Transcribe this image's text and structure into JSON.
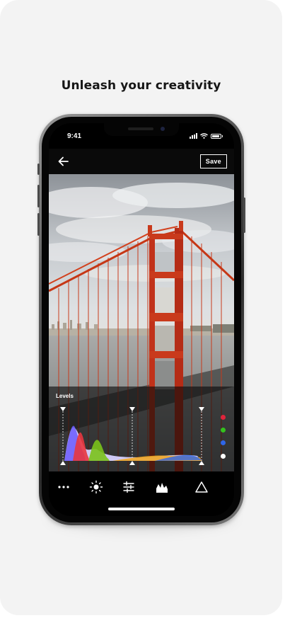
{
  "headline": "Unleash your creativity",
  "status": {
    "time": "9:41"
  },
  "editor": {
    "save_label": "Save",
    "panel_title": "Levels",
    "channel_dots": [
      {
        "name": "red-channel-dot",
        "color": "#e0243b"
      },
      {
        "name": "green-channel-dot",
        "color": "#34c11e"
      },
      {
        "name": "blue-channel-dot",
        "color": "#2f66e8"
      },
      {
        "name": "luminance-channel-dot",
        "color": "#ffffff"
      }
    ],
    "toolbar_icons": [
      "more-icon",
      "brightness-icon",
      "adjust-sliders-icon",
      "histogram-icon",
      "triangle-icon"
    ]
  },
  "colors": {
    "background": "#f3f3f3",
    "bridge": "#c93a1c",
    "headline": "#161616"
  }
}
